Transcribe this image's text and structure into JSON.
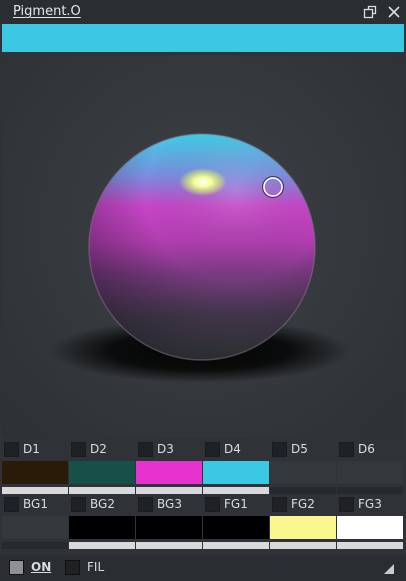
{
  "window": {
    "title": "Pigment.O",
    "popout_icon": "popout-icon",
    "close_icon": "close-icon"
  },
  "current_color": "#3ac8e2",
  "slots_row1": [
    {
      "label": "D1",
      "color": "#2a1a08",
      "bar": true
    },
    {
      "label": "D2",
      "color": "#175049",
      "bar": true
    },
    {
      "label": "D3",
      "color": "#e832cf",
      "bar": true
    },
    {
      "label": "D4",
      "color": "#3ac8e2",
      "bar": true
    },
    {
      "label": "D5",
      "color": "#33383c",
      "bar": false
    },
    {
      "label": "D6",
      "color": "#33383c",
      "bar": false
    }
  ],
  "slots_row2": [
    {
      "label": "BG1",
      "color": "#33383c",
      "bar": false
    },
    {
      "label": "BG2",
      "color": "#000000",
      "bar": true
    },
    {
      "label": "BG3",
      "color": "#000000",
      "bar": true
    },
    {
      "label": "FG1",
      "color": "#000000",
      "bar": true
    },
    {
      "label": "FG2",
      "color": "#fbf78f",
      "bar": true
    },
    {
      "label": "FG3",
      "color": "#ffffff",
      "bar": true
    }
  ],
  "bottom": {
    "on_label": "ON",
    "fil_label": "FIL",
    "resize_icon": "resize-grip-icon"
  }
}
